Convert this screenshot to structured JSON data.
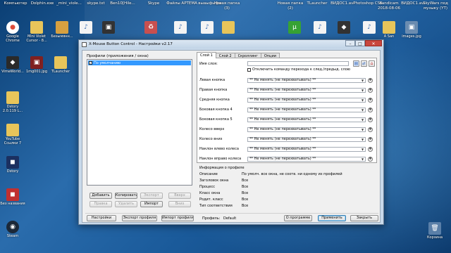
{
  "desktop": {
    "top_labels": [
      {
        "text": "Компьютер"
      },
      {
        "text": "Dolphin.exe"
      },
      {
        "text": "_mini_viole..."
      },
      {
        "text": "skype.txt"
      },
      {
        "text": "Ben10[Hile..."
      },
      {
        "text": "Skype"
      },
      {
        "text": "Файлы АРТЕМА"
      },
      {
        "text": "выаыфыфы"
      },
      {
        "text": "Новая папка (3)"
      },
      {
        "text": "Новая папка (2)"
      },
      {
        "text": "TLauncher"
      },
      {
        "text": "ВИДОС1.avi"
      },
      {
        "text": "Photoshop CS6"
      },
      {
        "text": "bandicam 2018-08-06"
      },
      {
        "text": "ВИДОС1.avi"
      },
      {
        "text": "SkyWars под музыку (YT)"
      }
    ],
    "icons": [
      {
        "name": "google-chrome-icon",
        "label": "Google Chrome",
        "glyph": "●",
        "color": "#dd4b39"
      },
      {
        "name": "folder-icon",
        "label": "Mini Violet Cursor - 8...",
        "glyph": "▇",
        "color": "#e8c55a"
      },
      {
        "name": "folder-icon",
        "label": "Безымянн...",
        "glyph": "▇",
        "color": "#d6a040"
      },
      {
        "name": "wma-icon",
        "label": "",
        "glyph": "♪",
        "color": "#3a6fb5"
      },
      {
        "name": "recycle-icon",
        "label": "",
        "glyph": "♻",
        "color": "#c85050"
      },
      {
        "name": "wma-icon",
        "label": "",
        "glyph": "♪",
        "color": "#3a6fb5"
      },
      {
        "name": "folder-icon",
        "label": "",
        "glyph": "▇",
        "color": "#e8c55a"
      },
      {
        "name": "utorrent-icon",
        "label": "",
        "glyph": "µ",
        "color": "#37a234"
      },
      {
        "name": "wma-icon",
        "label": "",
        "glyph": "♪",
        "color": "#3a6fb5"
      },
      {
        "name": "folder-icon",
        "label": "A San",
        "glyph": "▇",
        "color": "#e8c55a"
      },
      {
        "name": "image-icon",
        "label": "images.jpg",
        "glyph": "▣",
        "color": "#6b8cb0"
      },
      {
        "name": "vimeworld-icon",
        "label": "VimeWorld...",
        "glyph": "◆",
        "color": "#2a2a2a"
      },
      {
        "name": "image-icon",
        "label": "1mg001.jpg",
        "glyph": "▣",
        "color": "#802020"
      },
      {
        "name": "tlauncher-icon",
        "label": "TLauncher",
        "glyph": "▇",
        "color": "#e8c55a"
      },
      {
        "name": "folder-icon",
        "label": "Dstory 2.0.119 L...",
        "glyph": "▇",
        "color": "#e8c55a"
      },
      {
        "name": "folder-icon",
        "label": "YouTube Ссылки 7",
        "glyph": "▇",
        "color": "#e8c55a"
      },
      {
        "name": "app-icon",
        "label": "Dstory",
        "glyph": "◼",
        "color": "#1b3060"
      },
      {
        "name": "app-icon",
        "label": "Без названия",
        "glyph": "◼",
        "color": "#c03030"
      },
      {
        "name": "steam-icon",
        "label": "Steam",
        "glyph": "◉",
        "color": "#1b2838"
      },
      {
        "name": "recycle-bin-icon",
        "label": "Корзина",
        "glyph": "🗑",
        "color": "#5a7fa8"
      }
    ]
  },
  "window": {
    "title": "X-Mouse Button Control - Настройки v2.17",
    "controls": {
      "minimize": "–",
      "maximize": "□",
      "close": "✕"
    }
  },
  "left": {
    "profiles_label": "Профили (приложения / окна)",
    "profile_item": "По умолчанию",
    "buttons": {
      "add": "Добавить",
      "copy": "Копировать",
      "export": "Экспорт",
      "up": "Вверх",
      "edit": "Правка",
      "delete": "Удалить",
      "import": "Импорт",
      "down": "Вниз"
    }
  },
  "tabs": [
    "Слой 1",
    "Слой 2",
    "Скроллинг",
    "Опции"
  ],
  "panel": {
    "name_label": "Имя слоя:",
    "checkbox_label": "Отключить команду перехода к след./предыд. слою",
    "rows": [
      {
        "label": "Левая кнопка",
        "value": "** Не менять (не перехватывать) **"
      },
      {
        "label": "Правая кнопка",
        "value": "** Не менять (не перехватывать) **"
      },
      {
        "label": "Средняя кнопка",
        "value": "** Не менять (не перехватывать) **"
      },
      {
        "label": "Боковая кнопка 4",
        "value": "** Не менять (не перехватывать) **"
      },
      {
        "label": "Боковая кнопка 5",
        "value": "** Не менять (не перехватывать) **"
      },
      {
        "label": "Колесо вверх",
        "value": "** Не менять (не перехватывать) **"
      },
      {
        "label": "Колесо вниз",
        "value": "** Не менять (не перехватывать) **"
      },
      {
        "label": "Наклон влево колеса",
        "value": "** Не менять (не перехватывать) **"
      },
      {
        "label": "Наклон вправо колеса",
        "value": "** Не менять (не перехватывать) **"
      }
    ]
  },
  "info": {
    "title": "Информация о профиле",
    "rows": [
      {
        "k": "Описание",
        "v": "По умолч. все окна, не соотв. ни одному из профилей"
      },
      {
        "k": "Заголовок окна",
        "v": "Все"
      },
      {
        "k": "Процесс",
        "v": "Все"
      },
      {
        "k": "Класс окна",
        "v": "Все"
      },
      {
        "k": "Родит. класс",
        "v": "Все"
      },
      {
        "k": "Тип соответствия",
        "v": "Все"
      }
    ]
  },
  "footer": {
    "settings": "Настройки",
    "export_profile": "Экспорт профиля",
    "import_profile": "Импорт профиля",
    "profile_label": "Профиль:",
    "profile_value": "Default",
    "about": "О программе",
    "apply": "Применить",
    "close": "Закрыть"
  }
}
